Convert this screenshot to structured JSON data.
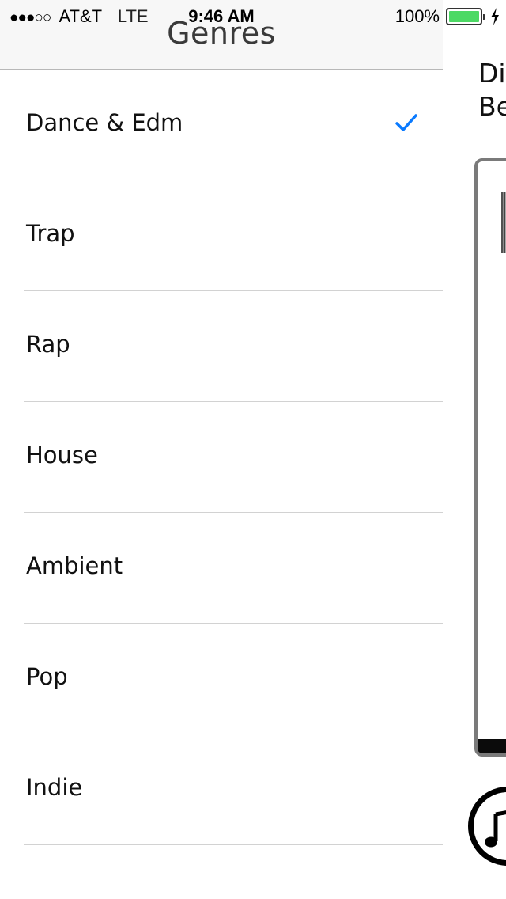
{
  "status_bar": {
    "signal": "●●●○○",
    "carrier": "AT&T",
    "network": "LTE",
    "time": "9:46 AM",
    "battery_percent": "100%",
    "battery_level": 1.0,
    "battery_color": "#4cd964",
    "charging_icon": "lightning-bolt-icon"
  },
  "drawer": {
    "title": "Genres",
    "genres": [
      {
        "label": "Dance & Edm",
        "selected": true
      },
      {
        "label": "Trap",
        "selected": false
      },
      {
        "label": "Rap",
        "selected": false
      },
      {
        "label": "House",
        "selected": false
      },
      {
        "label": "Ambient",
        "selected": false
      },
      {
        "label": "Pop",
        "selected": false
      },
      {
        "label": "Indie",
        "selected": false
      }
    ],
    "selected_icon": "checkmark-icon",
    "accent_color": "#0a7aff"
  },
  "main_panel": {
    "title_line1": "Di",
    "title_line2": "Be",
    "music_button_icon": "music-note-icon"
  }
}
